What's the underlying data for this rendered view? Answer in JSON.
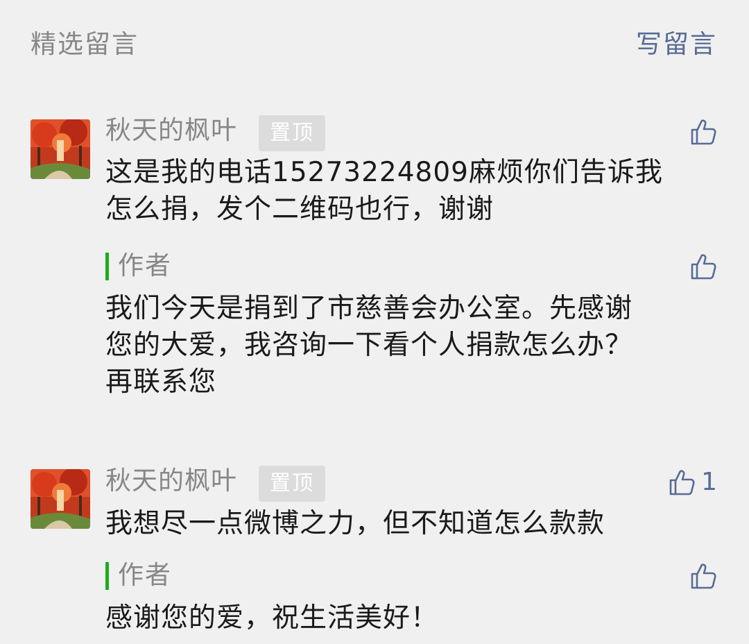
{
  "header": {
    "title": "精选留言",
    "write_label": "写留言"
  },
  "comments": [
    {
      "nickname": "秋天的枫叶",
      "badge": "置顶",
      "like_icon": "thumbs-up-icon",
      "like_count": "",
      "text_lines": [
        "这是我的电话15273224809麻烦你们告诉我",
        "怎么捐，发个二维码也行，谢谢"
      ],
      "reply": {
        "author_label": "作者",
        "like_icon": "thumbs-up-icon",
        "text_lines": [
          "我们今天是捐到了市慈善会办公室。先感谢",
          "您的大爱，我咨询一下看个人捐款怎么办？",
          "再联系您"
        ]
      }
    },
    {
      "nickname": "秋天的枫叶",
      "badge": "置顶",
      "like_icon": "thumbs-up-icon",
      "like_count": "1",
      "text_lines": [
        "我想尽一点微博之力，但不知道怎么款款"
      ],
      "reply": {
        "author_label": "作者",
        "like_icon": "thumbs-up-icon",
        "text_lines": [
          "感谢您的爱，祝生活美好！"
        ]
      }
    }
  ],
  "colors": {
    "link": "#576b95",
    "muted": "#878787",
    "author_mark": "#1aad19",
    "background": "#f0f0f0",
    "badge_bg": "#dcdcdc"
  }
}
